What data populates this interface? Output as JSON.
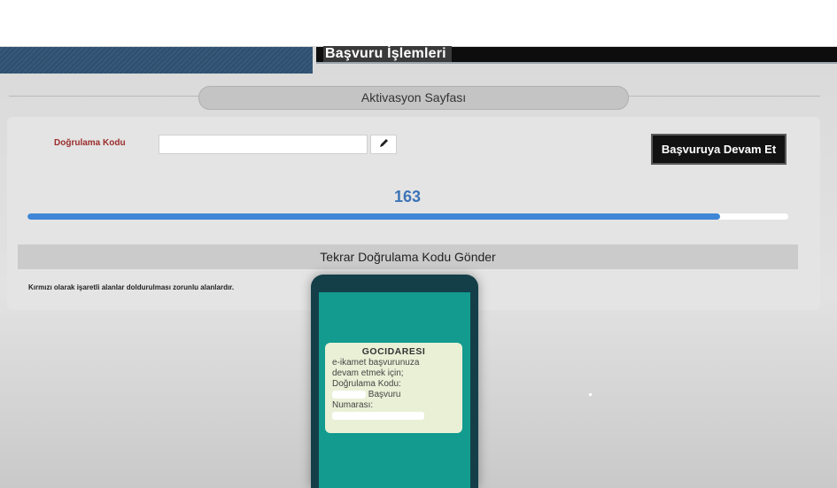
{
  "header": {
    "title": "Başvuru İşlemleri"
  },
  "page": {
    "title": "Aktivasyon Sayfası"
  },
  "form": {
    "code_label": "Doğrulama Kodu",
    "code_value": "",
    "continue_label": "Başvuruya Devam Et",
    "countdown": "163",
    "progress_fraction": 0.91,
    "resend_label": "Tekrar Doğrulama Kodu Gönder",
    "required_note": "Kırmızı olarak işaretli alanlar doldurulması zorunlu alanlardır."
  },
  "icons": {
    "edit": "pencil-icon"
  },
  "colors": {
    "accent": "#3f86d6",
    "required_label": "#9b2c2c",
    "phone_screen": "#129b8e"
  },
  "sms": {
    "sender": "GOCIDARESI",
    "line1": "e-ikamet başvurunuza",
    "line2": "devam etmek için;",
    "line3": "Doğrulama Kodu:",
    "line4": "Başvuru",
    "line5": "Numarası:"
  }
}
